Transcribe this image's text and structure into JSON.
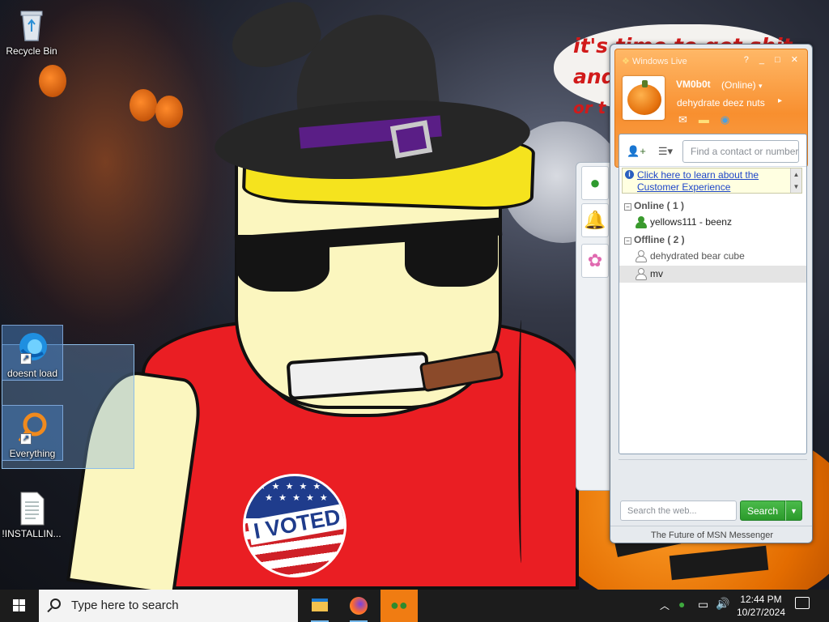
{
  "desktop": {
    "icons": [
      {
        "label": "Recycle Bin"
      },
      {
        "label": "doesnt load"
      },
      {
        "label": "Everything"
      },
      {
        "label": "!INSTALLIN..."
      }
    ]
  },
  "wallpaper": {
    "speech_lines": [
      "it's time to get shit",
      "and",
      "or t"
    ],
    "badge_text": "I VOTED"
  },
  "messenger": {
    "title": "Windows Live",
    "window_controls": "? _ □ ✕",
    "user": {
      "name": "VM0b0t",
      "status": "(Online)",
      "personal_message": "dehydrate deez nuts"
    },
    "find_placeholder": "Find a contact or number",
    "info_link": "Click here to learn about the Customer Experience",
    "groups": [
      {
        "label": "Online ( 1 )",
        "contacts": [
          {
            "name": "yellows111 - beenz",
            "online": true
          }
        ]
      },
      {
        "label": "Offline ( 2 )",
        "contacts": [
          {
            "name": "dehydrated bear cube",
            "online": false
          },
          {
            "name": "mv",
            "online": false,
            "selected": true
          }
        ]
      }
    ],
    "web_search_placeholder": "Search the web...",
    "search_button": "Search",
    "footer": "The Future of MSN Messenger",
    "accent_color": "#f88f2f"
  },
  "taskbar": {
    "search_placeholder": "Type here to search",
    "apps": [
      "file-explorer",
      "firefox",
      "windows-live-messenger"
    ],
    "clock_time": "12:44 PM",
    "clock_date": "10/27/2024"
  }
}
